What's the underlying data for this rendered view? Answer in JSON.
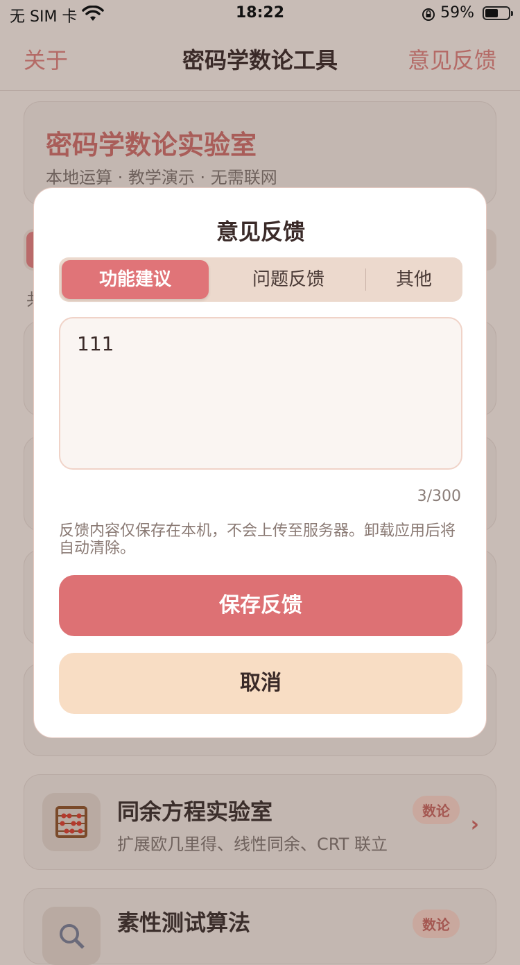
{
  "status_bar": {
    "carrier": "无 SIM 卡",
    "time": "18:22",
    "battery": "59%",
    "battery_level": 0.59
  },
  "nav": {
    "left": "关于",
    "title": "密码学数论工具",
    "right": "意见反馈"
  },
  "hero": {
    "title": "密码学数论实验室",
    "subtitle": "本地运算 · 教学演示 · 无需联网"
  },
  "partial_text": {
    "left_fragment": "共"
  },
  "list": [
    {
      "icon": "abacus-icon",
      "title": "同余方程实验室",
      "desc": "扩展欧几里得、线性同余、CRT 联立",
      "badge": "数论"
    },
    {
      "icon": "magnifier-icon",
      "title": "素性测试算法",
      "badge": "数论"
    }
  ],
  "modal": {
    "title": "意见反馈",
    "tabs": [
      "功能建议",
      "问题反馈",
      "其他"
    ],
    "active_tab": "功能建议",
    "input_value": "111",
    "counter": "3/300",
    "note": "反馈内容仅保存在本机，不会上传至服务器。卸载应用后将自动清除。",
    "save_label": "保存反馈",
    "cancel_label": "取消"
  },
  "colors": {
    "accent": "#dd7174",
    "cancel_bg": "#f8ddc4",
    "segment_bg": "#ecd9cd"
  }
}
